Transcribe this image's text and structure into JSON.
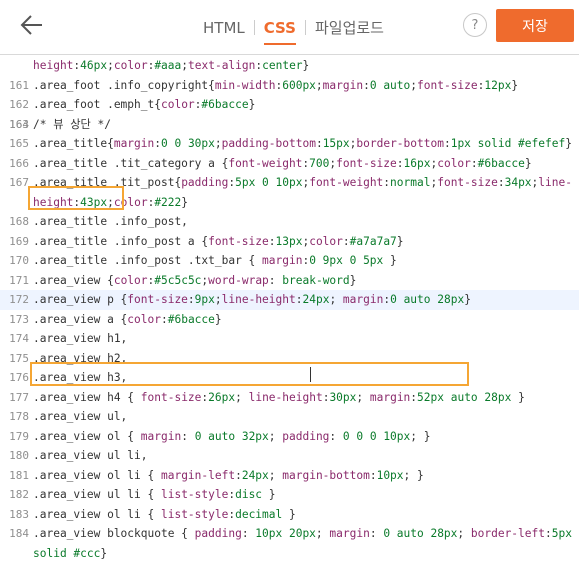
{
  "header": {
    "tabs": [
      {
        "label": "HTML"
      },
      {
        "label": "CSS"
      },
      {
        "label": "파일업로드"
      }
    ],
    "help_label": "?",
    "save_label": "저장"
  },
  "editor": {
    "lines": [
      {
        "num": "",
        "text": "height:46px;color:#aaa;text-align:center}"
      },
      {
        "num": "161",
        "text": ".area_foot .info_copyright{min-width:600px;margin:0 auto;font-size:12px}"
      },
      {
        "num": "162",
        "text": ".area_foot .emph_t{color:#6bacce}"
      },
      {
        "num": "163",
        "text": ""
      },
      {
        "num": "164",
        "text": "/* 뷰 상단 */"
      },
      {
        "num": "165",
        "text": ".area_title{margin:0 0 30px;padding-bottom:15px;border-bottom:1px solid #efefef}"
      },
      {
        "num": "166",
        "text": ".area_title .tit_category a {font-weight:700;font-size:16px;color:#6bacce}"
      },
      {
        "num": "167",
        "text": ".area_title .tit_post{padding:5px 0 10px;font-weight:normal;font-size:34px;line-height:43px;color:#222}"
      },
      {
        "num": "168",
        "text": ".area_title .info_post,"
      },
      {
        "num": "169",
        "text": ".area_title .info_post a {font-size:13px;color:#a7a7a7}"
      },
      {
        "num": "170",
        "text": ".area_title .info_post .txt_bar { margin:0 9px 0 5px }"
      },
      {
        "num": "171",
        "text": ".area_view {color:#5c5c5c;word-wrap: break-word}"
      },
      {
        "num": "172",
        "text": ".area_view p {font-size:9px;line-height:24px; margin:0 auto 28px}"
      },
      {
        "num": "173",
        "text": ".area_view a {color:#6bacce}"
      },
      {
        "num": "174",
        "text": ".area_view h1,"
      },
      {
        "num": "175",
        "text": ".area_view h2,"
      },
      {
        "num": "176",
        "text": ".area_view h3,"
      },
      {
        "num": "177",
        "text": ".area_view h4 { font-size:26px; line-height:30px; margin:52px auto 28px }"
      },
      {
        "num": "178",
        "text": ".area_view ul,"
      },
      {
        "num": "179",
        "text": ".area_view ol { margin: 0 auto 32px; padding: 0 0 0 10px; }"
      },
      {
        "num": "180",
        "text": ".area_view ul li,"
      },
      {
        "num": "181",
        "text": ".area_view ol li { margin-left:24px; margin-bottom:10px; }"
      },
      {
        "num": "182",
        "text": ".area_view ul li { list-style:disc }"
      },
      {
        "num": "183",
        "text": ".area_view ol li { list-style:decimal }"
      },
      {
        "num": "184",
        "text": ".area_view blockquote { padding: 10px 20px; margin: 0 auto 28px; border-left:5px solid #ccc}"
      }
    ],
    "current_line": "172"
  },
  "colors": {
    "accent": "#ef6b2d",
    "highlight_box": "#f5a634",
    "current_line_bg": "#eef4ff"
  }
}
